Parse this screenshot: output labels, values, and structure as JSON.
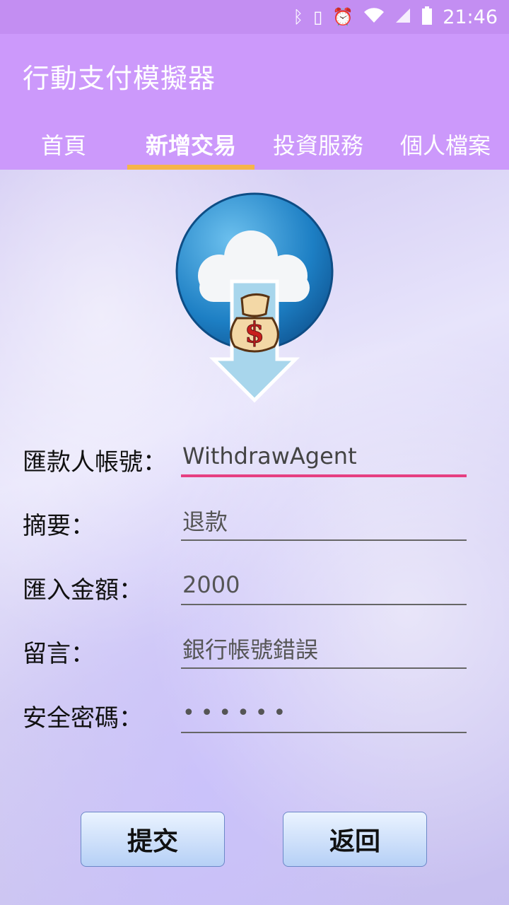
{
  "statusbar": {
    "time": "21:46",
    "icons": [
      "bluetooth-icon",
      "vibrate-icon",
      "alarm-icon",
      "wifi-icon",
      "signal-icon",
      "battery-icon"
    ]
  },
  "app": {
    "title": "行動支付模擬器",
    "colors": {
      "appbar": "#cc99fb",
      "statusbar": "#c38ef2",
      "tab_indicator": "#f6b44a",
      "focus_underline": "#e63f82"
    }
  },
  "tabs": [
    {
      "label": "首頁"
    },
    {
      "label": "新增交易",
      "active": true
    },
    {
      "label": "投資服務"
    },
    {
      "label": "個人檔案"
    }
  ],
  "form": {
    "payer_account": {
      "label": "匯款人帳號：",
      "value": "WithdrawAgent"
    },
    "summary": {
      "label": "摘要：",
      "value": "退款"
    },
    "amount": {
      "label": "匯入金額：",
      "value": "2000"
    },
    "message": {
      "label": "留言：",
      "value": "銀行帳號錯誤"
    },
    "password": {
      "label": "安全密碼：",
      "value": "••••••"
    }
  },
  "buttons": {
    "submit": "提交",
    "back": "返回"
  }
}
